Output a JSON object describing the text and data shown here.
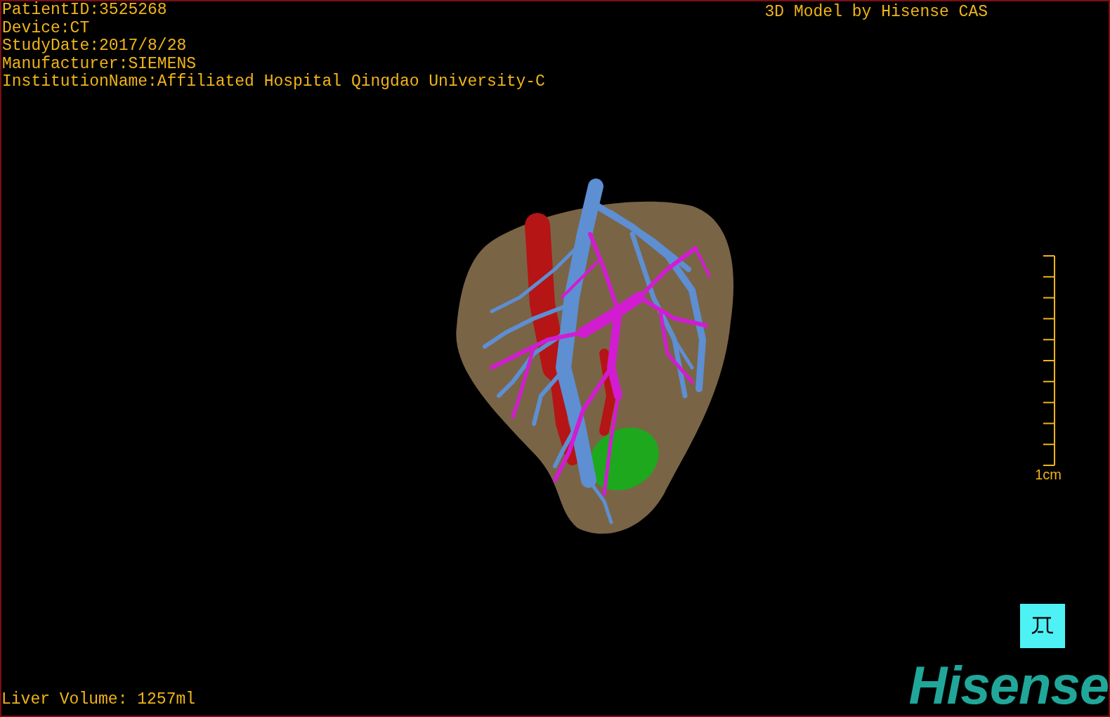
{
  "patient_info": [
    "PatientID:3525268",
    "Device:CT",
    "StudyDate:2017/8/28",
    "Manufacturer:SIEMENS",
    "InstitutionName:Affiliated Hospital Qingdao University-C"
  ],
  "title": "3D Model by Hisense CAS",
  "scale_bar": {
    "label": "1cm"
  },
  "liver_volume": "Liver Volume: 1257ml",
  "logo": "Hisense"
}
